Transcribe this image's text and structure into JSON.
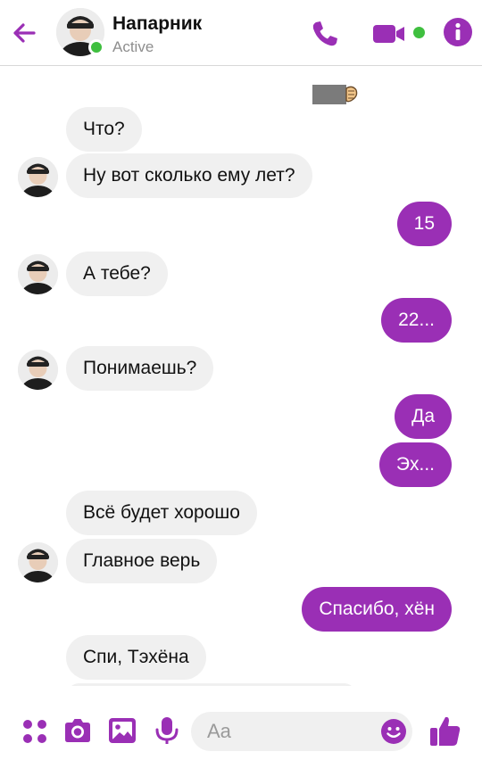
{
  "colors": {
    "accent": "#9a2fb5",
    "incoming_bubble": "#f0f0f0",
    "online": "#3fbf3f"
  },
  "header": {
    "name": "Напарник",
    "status": "Active",
    "icons": [
      "back-arrow-icon",
      "phone-icon",
      "video-camera-icon",
      "info-icon"
    ]
  },
  "messages": [
    {
      "from": "them",
      "text": "Что?"
    },
    {
      "from": "them",
      "text": "Ну вот сколько ему лет?"
    },
    {
      "from": "me",
      "text": "15"
    },
    {
      "from": "them",
      "text": "А тебе?"
    },
    {
      "from": "me",
      "text": "22..."
    },
    {
      "from": "them",
      "text": "Понимаешь?"
    },
    {
      "from": "me",
      "text": "Да"
    },
    {
      "from": "me",
      "text": "Эх..."
    },
    {
      "from": "them",
      "text": "Всё будет хорошо"
    },
    {
      "from": "them",
      "text": "Главное верь"
    },
    {
      "from": "me",
      "text": "Спасибо, хён"
    },
    {
      "from": "them",
      "text": "Спи, Тэхёна"
    }
  ],
  "composer": {
    "placeholder": "Aa",
    "icons": [
      "more-dots-icon",
      "camera-icon",
      "gallery-icon",
      "microphone-icon",
      "emoji-icon",
      "thumbs-up-icon"
    ]
  }
}
